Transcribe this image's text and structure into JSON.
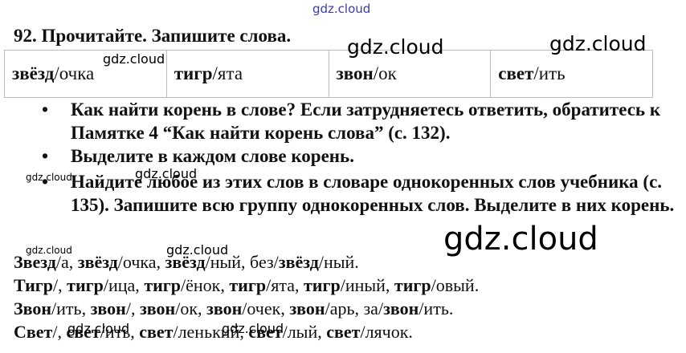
{
  "watermarks": {
    "top": "gdz.cloud",
    "t1": "gdz.cloud",
    "t2": "gdz.cloud",
    "t3": "gdz.cloud",
    "b1": "gdz.cloud",
    "b2": "gdz.cloud",
    "big": "gdz.cloud",
    "a1": "gdz.cloud",
    "a2": "gdz.cloud",
    "a3": "gdz.cloud",
    "a4": "gdz.cloud"
  },
  "exercise": {
    "title": "92. Прочитайте. Запишите слова."
  },
  "words": [
    {
      "root": "звёзд",
      "rest": "/очка"
    },
    {
      "root": "тигр",
      "rest": "/ята"
    },
    {
      "root": "звон",
      "rest": "/ок"
    },
    {
      "root": "свет",
      "rest": "/ить"
    }
  ],
  "bullets": [
    "Как найти корень в слове? Если затрудняетесь ответить, обратитесь к Памятке 4 “Как найти корень слова” (с. 132).",
    "Выделите в каждом слове корень.",
    "Найдите любое из этих слов в словаре однокоренных слов учебника (с. 135). Запишите всю группу однокоренных слов. Выделите в них корень."
  ],
  "answers": [
    [
      {
        "b": "Звезд",
        "t": "/а, "
      },
      {
        "b": "звёзд",
        "t": "/очка, "
      },
      {
        "b": "звёзд",
        "t": "/ный, без/"
      },
      {
        "b": "звёзд",
        "t": "/ный."
      }
    ],
    [
      {
        "b": "Тигр",
        "t": "/, "
      },
      {
        "b": "тигр",
        "t": "/ица, "
      },
      {
        "b": "тигр",
        "t": "/ёнок, "
      },
      {
        "b": "тигр",
        "t": "/ята, "
      },
      {
        "b": "тигр",
        "t": "/иный, "
      },
      {
        "b": "тигр",
        "t": "/овый."
      }
    ],
    [
      {
        "b": "Звон",
        "t": "/ить, "
      },
      {
        "b": "звон",
        "t": "/, "
      },
      {
        "b": "звон",
        "t": "/ок, "
      },
      {
        "b": "звон",
        "t": "/очек, "
      },
      {
        "b": "звон",
        "t": "/арь, за/"
      },
      {
        "b": "звон",
        "t": "/ить."
      }
    ],
    [
      {
        "b": "Свет",
        "t": "/, "
      },
      {
        "b": "свет",
        "t": "/ить, "
      },
      {
        "b": "свет",
        "t": "/ленький, "
      },
      {
        "b": "свет",
        "t": "/лый, "
      },
      {
        "b": "свет",
        "t": "/лячок."
      }
    ]
  ]
}
